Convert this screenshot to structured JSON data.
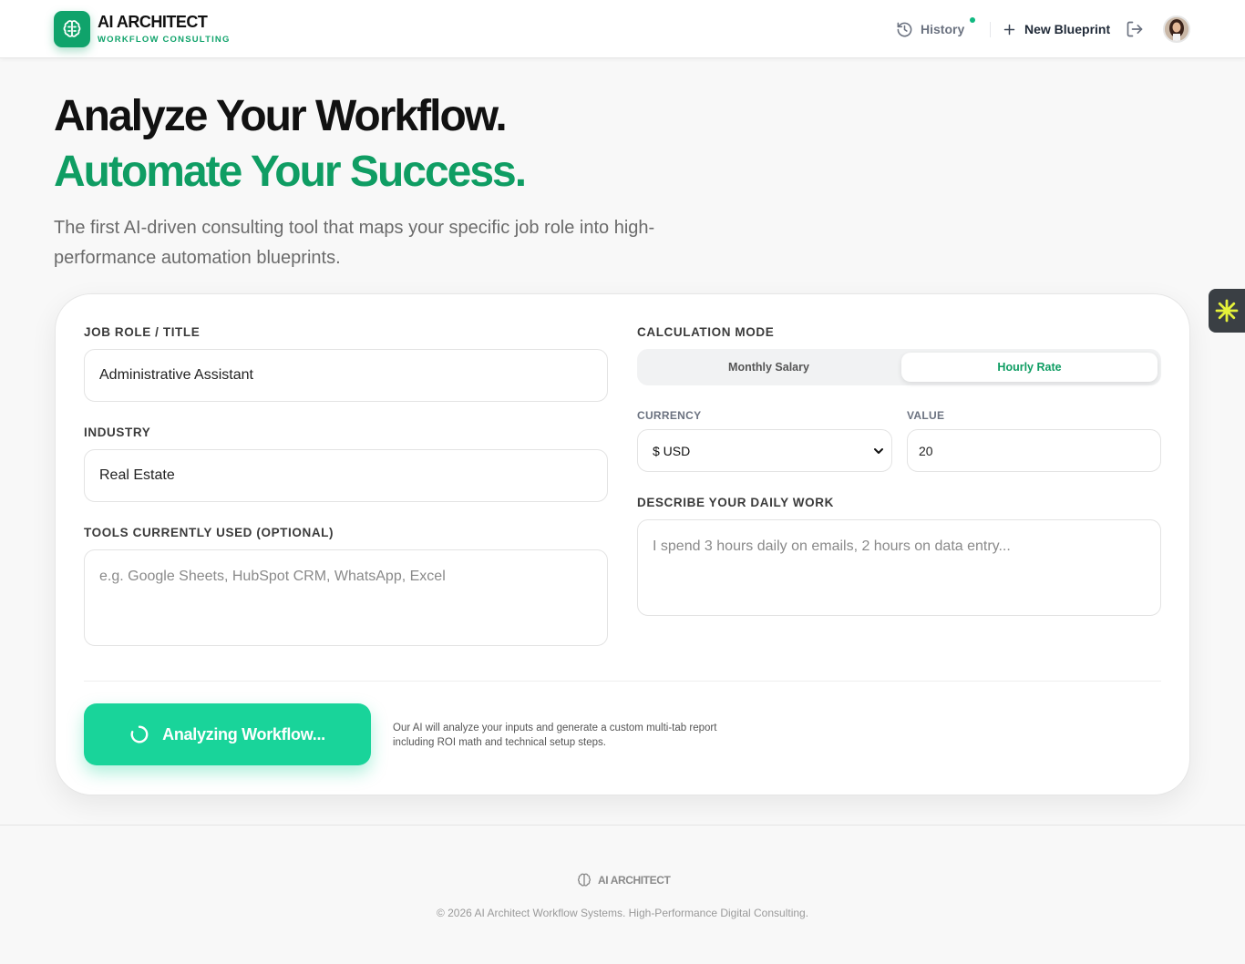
{
  "brand": {
    "name": "AI ARCHITECT",
    "subtitle": "WORKFLOW CONSULTING",
    "accent_color": "#10a36b",
    "logo_icon": "brain-icon"
  },
  "nav": {
    "history_label": "History",
    "history_icon": "history-icon",
    "new_blueprint_label": "New Blueprint",
    "new_blueprint_icon": "plus-icon",
    "logout_icon": "logout-icon",
    "avatar_icon": "user-avatar"
  },
  "hero": {
    "line1": "Analyze Your Workflow.",
    "line2": "Automate Your Success.",
    "description": "The first AI-driven consulting tool that maps your specific job role into high-performance automation blueprints."
  },
  "form": {
    "job_role": {
      "label": "JOB ROLE / TITLE",
      "value": "Administrative Assistant"
    },
    "industry": {
      "label": "INDUSTRY",
      "value": "Real Estate"
    },
    "tools": {
      "label": "TOOLS CURRENTLY USED (OPTIONAL)",
      "value": "",
      "placeholder": "e.g. Google Sheets, HubSpot CRM, WhatsApp, Excel"
    },
    "calc_mode": {
      "label": "CALCULATION MODE",
      "options": [
        "Monthly Salary",
        "Hourly Rate"
      ],
      "selected": "Hourly Rate"
    },
    "currency": {
      "label": "CURRENCY",
      "value": "$ USD"
    },
    "value": {
      "label": "VALUE",
      "value": "20"
    },
    "daily_work": {
      "label": "DESCRIBE YOUR DAILY WORK",
      "value": "",
      "placeholder": "I spend 3 hours daily on emails, 2 hours on data entry..."
    },
    "submit_label": "Analyzing Workflow...",
    "submit_note": "Our AI will analyze your inputs and generate a custom multi-tab report including ROI math and technical setup steps."
  },
  "footer": {
    "brand": "AI ARCHITECT",
    "copyright": "© 2026 AI Architect Workflow Systems. High-Performance Digital Consulting."
  }
}
